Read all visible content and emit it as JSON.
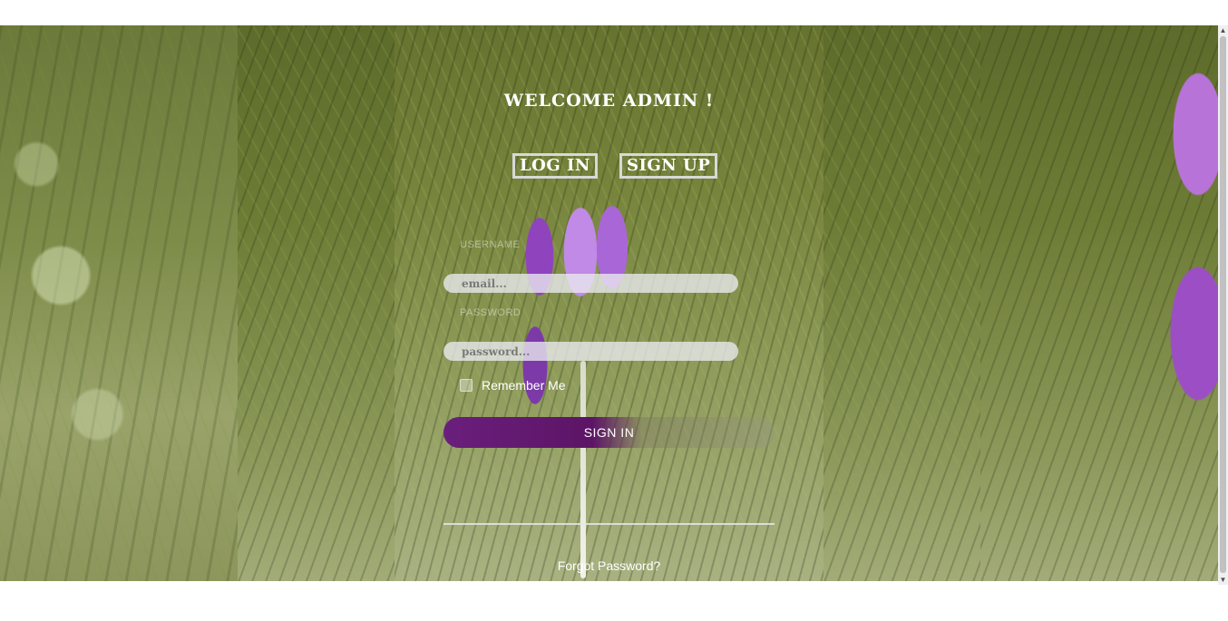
{
  "header": {
    "title": "WELCOME ADMIN !"
  },
  "tabs": [
    {
      "label": "LOG IN"
    },
    {
      "label": "SIGN UP"
    }
  ],
  "form": {
    "username_label": "USERNAME",
    "email_placeholder": "email...",
    "password_label": "PASSWORD",
    "password_placeholder": "password...",
    "remember_label": "Remember Me",
    "submit_label": "SIGN IN",
    "forgot_label": "Forgot Password?"
  },
  "scrollbar": {
    "up_icon": "▲",
    "down_icon": "▼"
  },
  "colors": {
    "accent": "#5c1466",
    "text": "#ffffff",
    "input_bg": "#ebebf0"
  }
}
